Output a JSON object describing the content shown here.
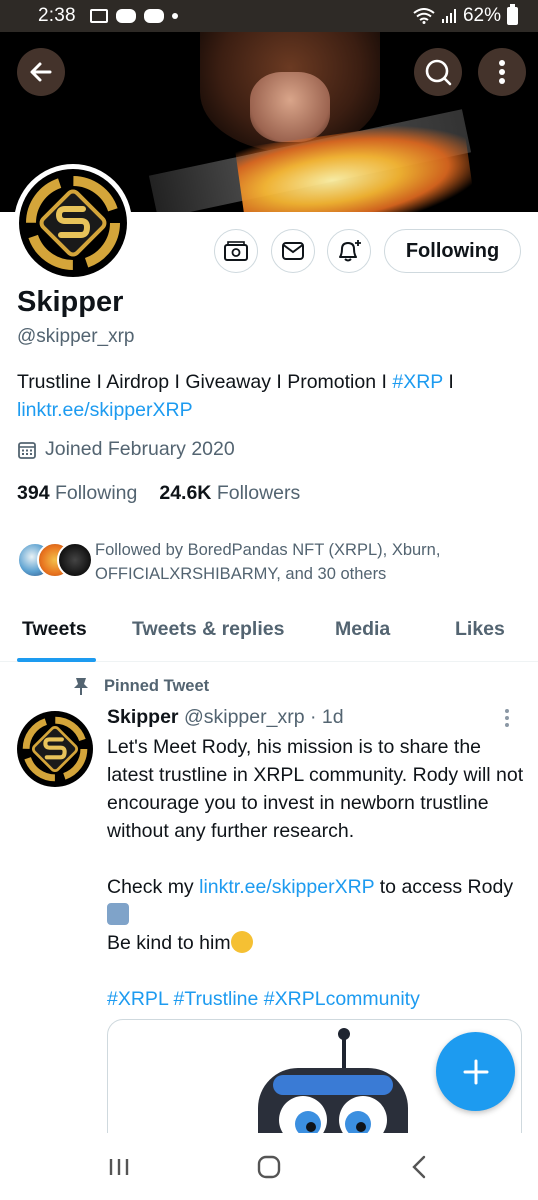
{
  "status_bar": {
    "time": "2:38",
    "battery": "62%"
  },
  "profile": {
    "name": "Skipper",
    "handle": "@skipper_xrp",
    "bio_text": "Trustline I Airdrop I Giveaway I Promotion I ",
    "bio_hashtag": "#XRP",
    "bio_separator": " I",
    "bio_link": "linktr.ee/skipperXRP",
    "joined": "Joined February 2020",
    "following_count": "394",
    "following_label": "Following",
    "followers_count": "24.6K",
    "followers_label": "Followers",
    "followed_by": "Followed by BoredPandas NFT (XRPL), Xburn, OFFICIALXRSHIBARMY, and 30 others",
    "follow_button": "Following"
  },
  "tabs": [
    {
      "label": "Tweets",
      "active": true
    },
    {
      "label": "Tweets & replies",
      "active": false
    },
    {
      "label": "Media",
      "active": false
    },
    {
      "label": "Likes",
      "active": false
    }
  ],
  "tweet": {
    "pinned_label": "Pinned Tweet",
    "author_name": "Skipper",
    "author_handle": "@skipper_xrp",
    "time": "· 1d",
    "line1": "Let's Meet Rody, his mission is to share the latest trustline in XRPL community. Rody will not encourage you to invest in newborn trustline without any further research.",
    "check_prefix": "Check my ",
    "check_link": "linktr.ee/skipperXRP",
    "check_suffix": " to access Rody",
    "kind": "Be kind to him",
    "hashtags": "#XRPL #Trustline #XRPLcommunity"
  },
  "colors": {
    "accent": "#1d9bf0",
    "text_primary": "#0f1419",
    "text_secondary": "#536471",
    "border": "#cfd9de",
    "status_bar_bg": "#2e2a26"
  },
  "icons": {
    "back": "arrow-left-icon",
    "search": "search-icon",
    "more": "more-vertical-icon",
    "tip": "tip-jar-icon",
    "message": "envelope-icon",
    "notify": "bell-plus-icon",
    "calendar": "calendar-icon",
    "pin": "pin-icon",
    "compose": "plus-icon"
  }
}
